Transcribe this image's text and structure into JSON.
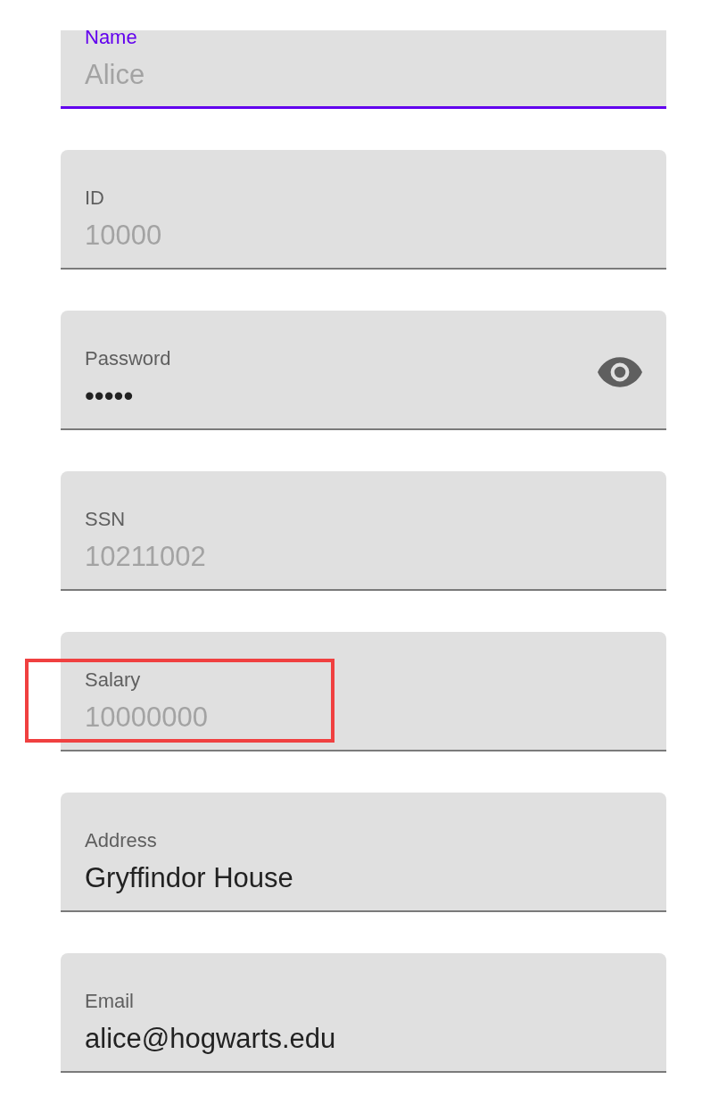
{
  "fields": [
    {
      "kind": "text",
      "label": "Name",
      "value": "Alice",
      "disabled": true,
      "focused": true,
      "highlighted": false
    },
    {
      "kind": "text",
      "label": "ID",
      "value": "10000",
      "disabled": true,
      "focused": false,
      "highlighted": false
    },
    {
      "kind": "password",
      "label": "Password",
      "value": "•••••",
      "disabled": false,
      "focused": false,
      "highlighted": false
    },
    {
      "kind": "text",
      "label": "SSN",
      "value": "10211002",
      "disabled": true,
      "focused": false,
      "highlighted": false
    },
    {
      "kind": "text",
      "label": "Salary",
      "value": "10000000",
      "disabled": true,
      "focused": false,
      "highlighted": true
    },
    {
      "kind": "text",
      "label": "Address",
      "value": "Gryffindor House",
      "disabled": false,
      "focused": false,
      "highlighted": false
    },
    {
      "kind": "text",
      "label": "Email",
      "value": "alice@hogwarts.edu",
      "disabled": false,
      "focused": false,
      "highlighted": false
    }
  ]
}
